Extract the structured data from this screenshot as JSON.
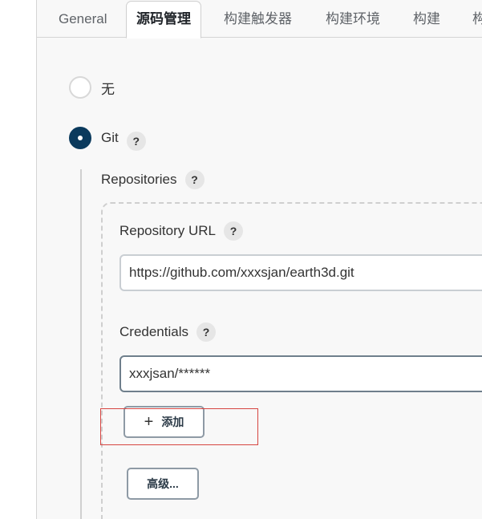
{
  "tabs": [
    {
      "label": "General"
    },
    {
      "label": "源码管理",
      "active": true
    },
    {
      "label": "构建触发器"
    },
    {
      "label": "构建环境"
    },
    {
      "label": "构建"
    },
    {
      "label": "构"
    }
  ],
  "scm": {
    "none_label": "无",
    "git_label": "Git",
    "help_glyph": "?"
  },
  "repositories": {
    "label": "Repositories",
    "url_label": "Repository URL",
    "url_value": "https://github.com/xxxsjan/earth3d.git",
    "credentials_label": "Credentials",
    "credentials_value": "xxxjsan/******",
    "add_button": "添加",
    "add_icon": "+",
    "advanced_button": "高级..."
  },
  "colors": {
    "selected_radio": "#0b3a5d",
    "highlight_border": "#d64541"
  }
}
